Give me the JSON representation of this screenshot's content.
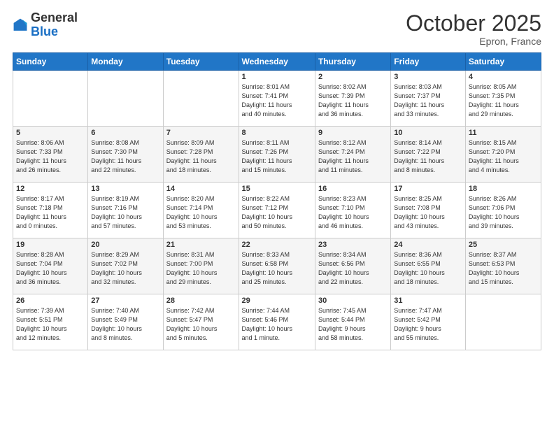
{
  "logo": {
    "general": "General",
    "blue": "Blue"
  },
  "title": "October 2025",
  "location": "Epron, France",
  "days_header": [
    "Sunday",
    "Monday",
    "Tuesday",
    "Wednesday",
    "Thursday",
    "Friday",
    "Saturday"
  ],
  "weeks": [
    [
      {
        "day": "",
        "info": ""
      },
      {
        "day": "",
        "info": ""
      },
      {
        "day": "",
        "info": ""
      },
      {
        "day": "1",
        "info": "Sunrise: 8:01 AM\nSunset: 7:41 PM\nDaylight: 11 hours\nand 40 minutes."
      },
      {
        "day": "2",
        "info": "Sunrise: 8:02 AM\nSunset: 7:39 PM\nDaylight: 11 hours\nand 36 minutes."
      },
      {
        "day": "3",
        "info": "Sunrise: 8:03 AM\nSunset: 7:37 PM\nDaylight: 11 hours\nand 33 minutes."
      },
      {
        "day": "4",
        "info": "Sunrise: 8:05 AM\nSunset: 7:35 PM\nDaylight: 11 hours\nand 29 minutes."
      }
    ],
    [
      {
        "day": "5",
        "info": "Sunrise: 8:06 AM\nSunset: 7:33 PM\nDaylight: 11 hours\nand 26 minutes."
      },
      {
        "day": "6",
        "info": "Sunrise: 8:08 AM\nSunset: 7:30 PM\nDaylight: 11 hours\nand 22 minutes."
      },
      {
        "day": "7",
        "info": "Sunrise: 8:09 AM\nSunset: 7:28 PM\nDaylight: 11 hours\nand 18 minutes."
      },
      {
        "day": "8",
        "info": "Sunrise: 8:11 AM\nSunset: 7:26 PM\nDaylight: 11 hours\nand 15 minutes."
      },
      {
        "day": "9",
        "info": "Sunrise: 8:12 AM\nSunset: 7:24 PM\nDaylight: 11 hours\nand 11 minutes."
      },
      {
        "day": "10",
        "info": "Sunrise: 8:14 AM\nSunset: 7:22 PM\nDaylight: 11 hours\nand 8 minutes."
      },
      {
        "day": "11",
        "info": "Sunrise: 8:15 AM\nSunset: 7:20 PM\nDaylight: 11 hours\nand 4 minutes."
      }
    ],
    [
      {
        "day": "12",
        "info": "Sunrise: 8:17 AM\nSunset: 7:18 PM\nDaylight: 11 hours\nand 0 minutes."
      },
      {
        "day": "13",
        "info": "Sunrise: 8:19 AM\nSunset: 7:16 PM\nDaylight: 10 hours\nand 57 minutes."
      },
      {
        "day": "14",
        "info": "Sunrise: 8:20 AM\nSunset: 7:14 PM\nDaylight: 10 hours\nand 53 minutes."
      },
      {
        "day": "15",
        "info": "Sunrise: 8:22 AM\nSunset: 7:12 PM\nDaylight: 10 hours\nand 50 minutes."
      },
      {
        "day": "16",
        "info": "Sunrise: 8:23 AM\nSunset: 7:10 PM\nDaylight: 10 hours\nand 46 minutes."
      },
      {
        "day": "17",
        "info": "Sunrise: 8:25 AM\nSunset: 7:08 PM\nDaylight: 10 hours\nand 43 minutes."
      },
      {
        "day": "18",
        "info": "Sunrise: 8:26 AM\nSunset: 7:06 PM\nDaylight: 10 hours\nand 39 minutes."
      }
    ],
    [
      {
        "day": "19",
        "info": "Sunrise: 8:28 AM\nSunset: 7:04 PM\nDaylight: 10 hours\nand 36 minutes."
      },
      {
        "day": "20",
        "info": "Sunrise: 8:29 AM\nSunset: 7:02 PM\nDaylight: 10 hours\nand 32 minutes."
      },
      {
        "day": "21",
        "info": "Sunrise: 8:31 AM\nSunset: 7:00 PM\nDaylight: 10 hours\nand 29 minutes."
      },
      {
        "day": "22",
        "info": "Sunrise: 8:33 AM\nSunset: 6:58 PM\nDaylight: 10 hours\nand 25 minutes."
      },
      {
        "day": "23",
        "info": "Sunrise: 8:34 AM\nSunset: 6:56 PM\nDaylight: 10 hours\nand 22 minutes."
      },
      {
        "day": "24",
        "info": "Sunrise: 8:36 AM\nSunset: 6:55 PM\nDaylight: 10 hours\nand 18 minutes."
      },
      {
        "day": "25",
        "info": "Sunrise: 8:37 AM\nSunset: 6:53 PM\nDaylight: 10 hours\nand 15 minutes."
      }
    ],
    [
      {
        "day": "26",
        "info": "Sunrise: 7:39 AM\nSunset: 5:51 PM\nDaylight: 10 hours\nand 12 minutes."
      },
      {
        "day": "27",
        "info": "Sunrise: 7:40 AM\nSunset: 5:49 PM\nDaylight: 10 hours\nand 8 minutes."
      },
      {
        "day": "28",
        "info": "Sunrise: 7:42 AM\nSunset: 5:47 PM\nDaylight: 10 hours\nand 5 minutes."
      },
      {
        "day": "29",
        "info": "Sunrise: 7:44 AM\nSunset: 5:46 PM\nDaylight: 10 hours\nand 1 minute."
      },
      {
        "day": "30",
        "info": "Sunrise: 7:45 AM\nSunset: 5:44 PM\nDaylight: 9 hours\nand 58 minutes."
      },
      {
        "day": "31",
        "info": "Sunrise: 7:47 AM\nSunset: 5:42 PM\nDaylight: 9 hours\nand 55 minutes."
      },
      {
        "day": "",
        "info": ""
      }
    ]
  ]
}
